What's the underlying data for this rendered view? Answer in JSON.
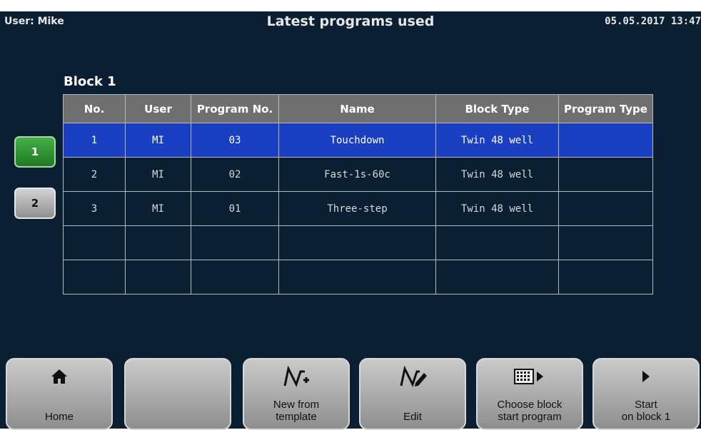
{
  "header": {
    "user": "User: Mike",
    "title": "Latest programs used",
    "datetime": "05.05.2017 13:47"
  },
  "block_label": "Block 1",
  "table": {
    "columns": [
      "No.",
      "User",
      "Program No.",
      "Name",
      "Block Type",
      "Program Type"
    ],
    "rows": [
      [
        "1",
        "MI",
        "03",
        "Touchdown",
        "Twin 48 well",
        ""
      ],
      [
        "2",
        "MI",
        "02",
        "Fast-1s-60c",
        "Twin 48 well",
        ""
      ],
      [
        "3",
        "MI",
        "01",
        "Three-step",
        "Twin 48 well",
        ""
      ],
      [
        "",
        "",
        "",
        "",
        "",
        ""
      ],
      [
        "",
        "",
        "",
        "",
        "",
        ""
      ]
    ],
    "selected_row": 0
  },
  "block_buttons": [
    "1",
    "2"
  ],
  "softkeys": [
    {
      "label": "Home",
      "icon": "home-icon"
    },
    {
      "label": "",
      "icon": ""
    },
    {
      "label": "New from\ntemplate",
      "icon": "new-template-icon"
    },
    {
      "label": "Edit",
      "icon": "edit-icon"
    },
    {
      "label": "Choose block\nstart program",
      "icon": "block-grid-icon"
    },
    {
      "label": "Start\non block 1",
      "icon": "play-icon"
    }
  ],
  "colors": {
    "background": "#0b1f33",
    "selected_row": "#1a3fc2",
    "active_block": "#2a9a30"
  }
}
